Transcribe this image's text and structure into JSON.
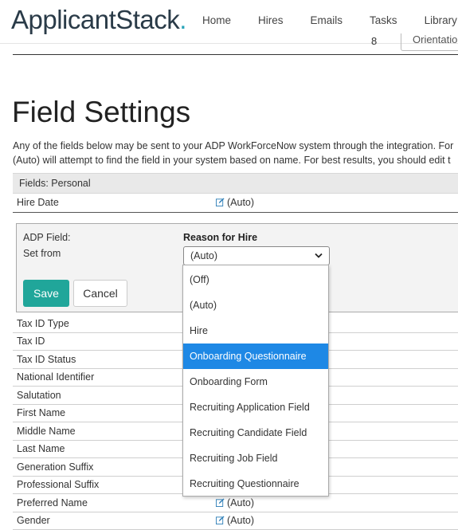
{
  "header": {
    "logo": {
      "main": "ApplicantStack",
      "dot": "."
    },
    "nav": [
      "Home",
      "Hires",
      "Emails",
      "Tasks",
      "Library"
    ]
  },
  "subbar": {
    "select_value": "Orientation",
    "icon_glyph": "8"
  },
  "page": {
    "title": "Field Settings",
    "desc_line1": "Any of the fields below may be sent to your ADP WorkForceNow system through the integration. For",
    "desc_line2": "(Auto) will attempt to find the field in your system based on name. For best results, you should edit t"
  },
  "section": {
    "label": "Fields: Personal"
  },
  "hire_row": {
    "label": "Hire Date",
    "value": "(Auto)"
  },
  "editor": {
    "adp_field_label": "ADP Field:",
    "set_from_label": "Set from",
    "field_name": "Reason for Hire",
    "select_value": "(Auto)",
    "save_label": "Save",
    "cancel_label": "Cancel"
  },
  "dropdown": {
    "options": [
      "(Off)",
      "(Auto)",
      "Hire",
      "Onboarding Questionnaire",
      "Onboarding Form",
      "Recruiting Application Field",
      "Recruiting Candidate Field",
      "Recruiting Job Field",
      "Recruiting Questionnaire"
    ],
    "selected_index": 3
  },
  "rows": [
    {
      "label": "Tax ID Type",
      "value": ""
    },
    {
      "label": "Tax ID",
      "value": ""
    },
    {
      "label": "Tax ID Status",
      "value": ""
    },
    {
      "label": "National Identifier",
      "value": ""
    },
    {
      "label": "Salutation",
      "value": ""
    },
    {
      "label": "First Name",
      "value": ""
    },
    {
      "label": "Middle Name",
      "value": ""
    },
    {
      "label": "Last Name",
      "value": ""
    },
    {
      "label": "Generation Suffix",
      "value": ""
    },
    {
      "label": "Professional Suffix",
      "value": ""
    },
    {
      "label": "Preferred Name",
      "value": "(Auto)"
    },
    {
      "label": "Gender",
      "value": "(Auto)"
    }
  ],
  "colors": {
    "accent": "#20a69a",
    "selected": "#1e88e5",
    "logo": "#2a3b48",
    "logo_dot": "#27a3b8"
  }
}
